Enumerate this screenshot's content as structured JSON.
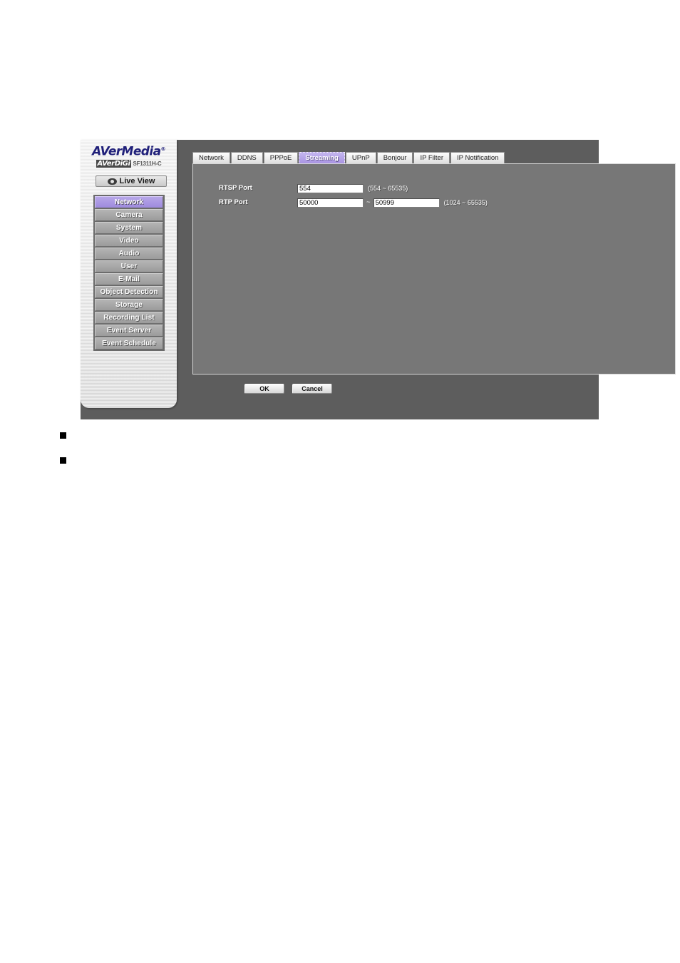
{
  "branding": {
    "company": "AVerMedia",
    "trademark": "®",
    "product_line": "AVerDiGi",
    "model": "SF1311H-C"
  },
  "live_view": {
    "label": "Live View",
    "icon": "eye-icon"
  },
  "sidebar": {
    "items": [
      {
        "label": "Network",
        "selected": true
      },
      {
        "label": "Camera",
        "selected": false
      },
      {
        "label": "System",
        "selected": false
      },
      {
        "label": "Video",
        "selected": false
      },
      {
        "label": "Audio",
        "selected": false
      },
      {
        "label": "User",
        "selected": false
      },
      {
        "label": "E-Mail",
        "selected": false
      },
      {
        "label": "Object Detection",
        "selected": false
      },
      {
        "label": "Storage",
        "selected": false
      },
      {
        "label": "Recording List",
        "selected": false
      },
      {
        "label": "Event Server",
        "selected": false
      },
      {
        "label": "Event Schedule",
        "selected": false
      }
    ]
  },
  "tabs": [
    {
      "label": "Network",
      "active": false
    },
    {
      "label": "DDNS",
      "active": false
    },
    {
      "label": "PPPoE",
      "active": false
    },
    {
      "label": "Streaming",
      "active": true
    },
    {
      "label": "UPnP",
      "active": false
    },
    {
      "label": "Bonjour",
      "active": false
    },
    {
      "label": "IP Filter",
      "active": false
    },
    {
      "label": "IP Notification",
      "active": false
    }
  ],
  "form": {
    "rtsp": {
      "label": "RTSP Port",
      "value": "554",
      "hint": "(554 ~ 65535)"
    },
    "rtp": {
      "label": "RTP Port",
      "value_start": "50000",
      "value_end": "50999",
      "separator": "~",
      "hint": "(1024 ~ 65535)"
    }
  },
  "actions": {
    "ok_label": "OK",
    "cancel_label": "Cancel"
  },
  "colors": {
    "accent_purple": "#9e8ade",
    "window_bg": "#5d5d5d",
    "panel_bg": "#777777",
    "brand_blue": "#20207a"
  }
}
